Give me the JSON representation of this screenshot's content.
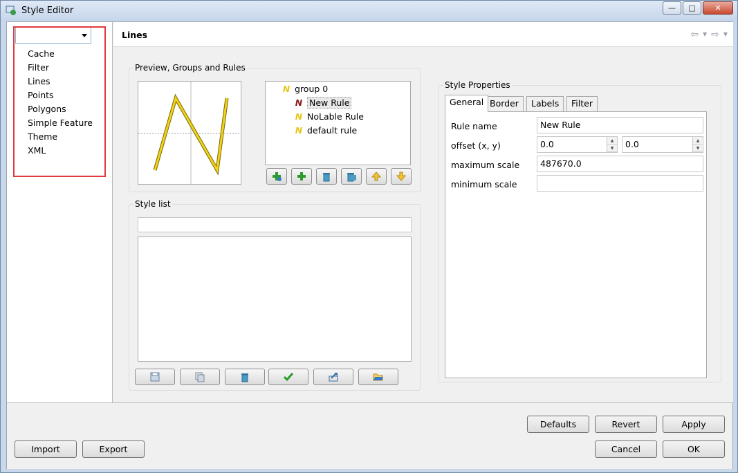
{
  "window": {
    "title": "Style Editor"
  },
  "sidebar": {
    "combo_value": "",
    "items": [
      "Cache",
      "Filter",
      "Lines",
      "Points",
      "Polygons",
      "Simple Feature",
      "Theme",
      "XML"
    ]
  },
  "main": {
    "title": "Lines",
    "preview_group": {
      "label": "Preview, Groups and Rules",
      "tree": [
        {
          "label": "group 0",
          "icon": "line-symbol-icon"
        },
        {
          "label": "New Rule",
          "icon": "line-symbol-red-icon"
        },
        {
          "label": "NoLable Rule",
          "icon": "line-symbol-icon"
        },
        {
          "label": "default rule",
          "icon": "line-symbol-icon"
        }
      ],
      "buttons": [
        "add-group-icon",
        "add-rule-icon",
        "delete-icon",
        "delete-all-icon",
        "move-up-icon",
        "move-down-icon"
      ]
    },
    "style_list": {
      "label": "Style list",
      "filter_value": "",
      "buttons": [
        "save-icon",
        "copy-icon",
        "delete-icon",
        "apply-check-icon",
        "export-icon",
        "open-folder-icon"
      ]
    },
    "style_properties": {
      "label": "Style Properties",
      "tabs": [
        "General",
        "Border",
        "Labels",
        "Filter"
      ],
      "active_tab": "General",
      "fields": {
        "rule_name": {
          "label": "Rule name",
          "value": "New Rule"
        },
        "offset": {
          "label": "offset (x, y)",
          "x": "0.0",
          "y": "0.0"
        },
        "max_scale": {
          "label": "maximum scale",
          "value": "487670.0"
        },
        "min_scale": {
          "label": "minimum scale",
          "value": ""
        }
      }
    }
  },
  "footer": {
    "defaults": "Defaults",
    "revert": "Revert",
    "apply": "Apply",
    "import": "Import",
    "export": "Export",
    "cancel": "Cancel",
    "ok": "OK"
  },
  "colors": {
    "highlight_box": "#e0393e",
    "line_symbol": "#e6c619",
    "line_symbol_selected": "#8b1a1a"
  }
}
